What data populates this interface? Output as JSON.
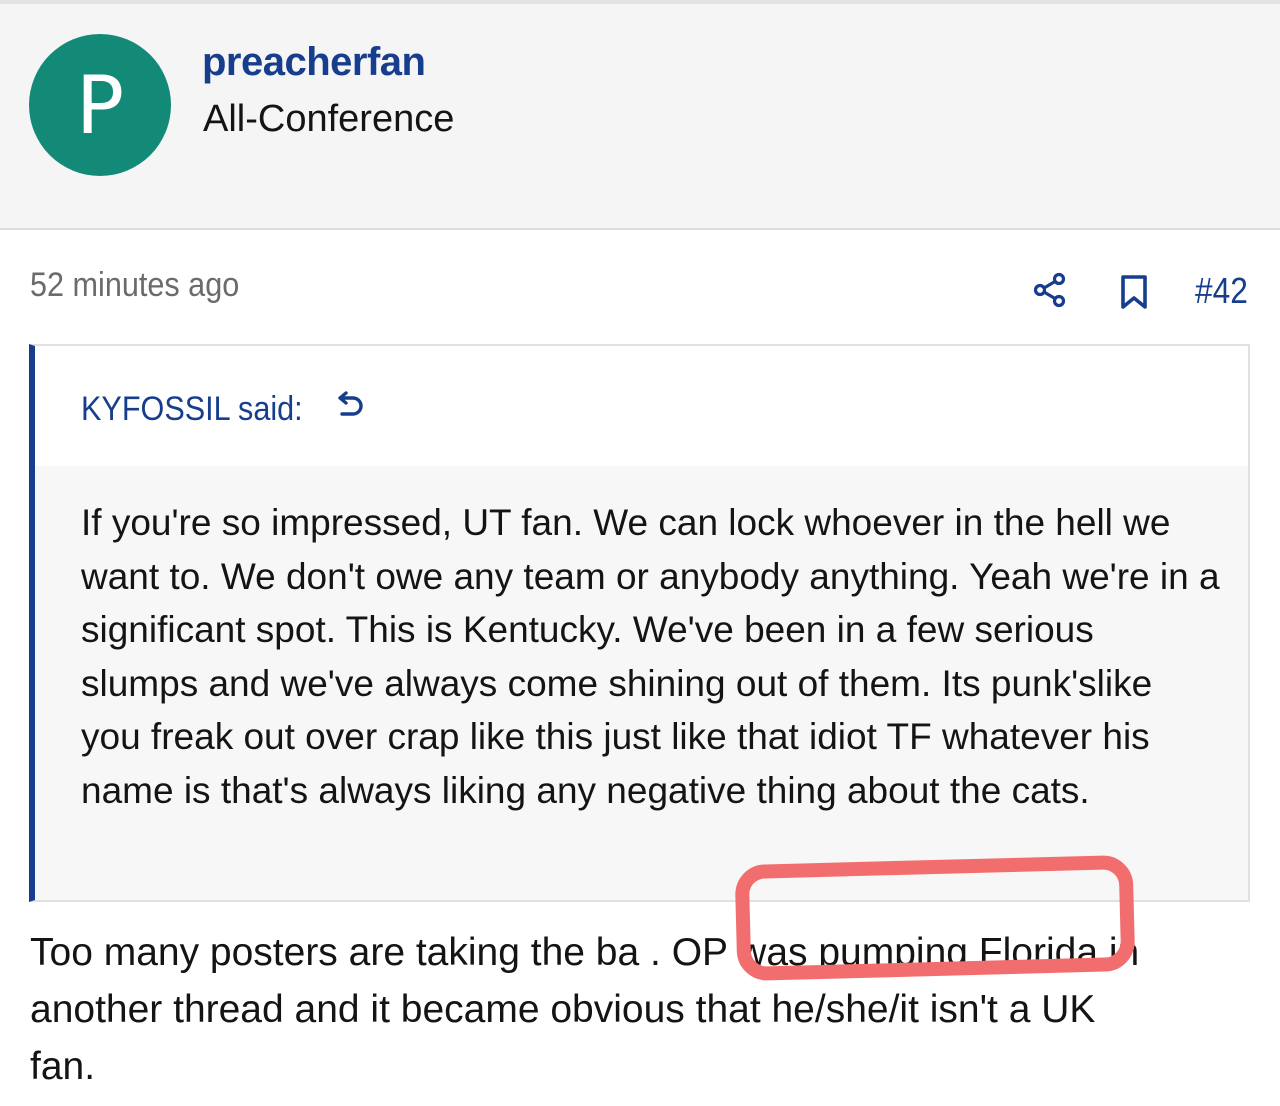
{
  "user": {
    "avatar_letter": "P",
    "avatar_color": "#138a78",
    "username": "preacherfan",
    "title": "All-Conference"
  },
  "post": {
    "timestamp": "52 minutes ago",
    "share_icon": "share-icon",
    "bookmark_icon": "bookmark-icon",
    "number": "#42"
  },
  "quote": {
    "author": "KYFOSSIL said:",
    "jump_icon": "undo-arrow-icon",
    "text": "If you're so impressed, UT fan. We can lock whoever in the hell we want to. We don't owe any team or anybody anything. Yeah we're in a significant spot. This is Kentucky. We've been in a few serious slumps and we've always come shining out of them. Its punk'slike you freak out over crap like this just like that idiot TF whatever his name is that's always liking any negative thing about the cats."
  },
  "reply": {
    "text": "Too many posters are taking the ba . OP was pumping Florida in another thread and it became obvious that he/she/it isn't a UK fan."
  },
  "colors": {
    "link_blue": "#173e8c",
    "highlight_red": "#f26e6e"
  }
}
